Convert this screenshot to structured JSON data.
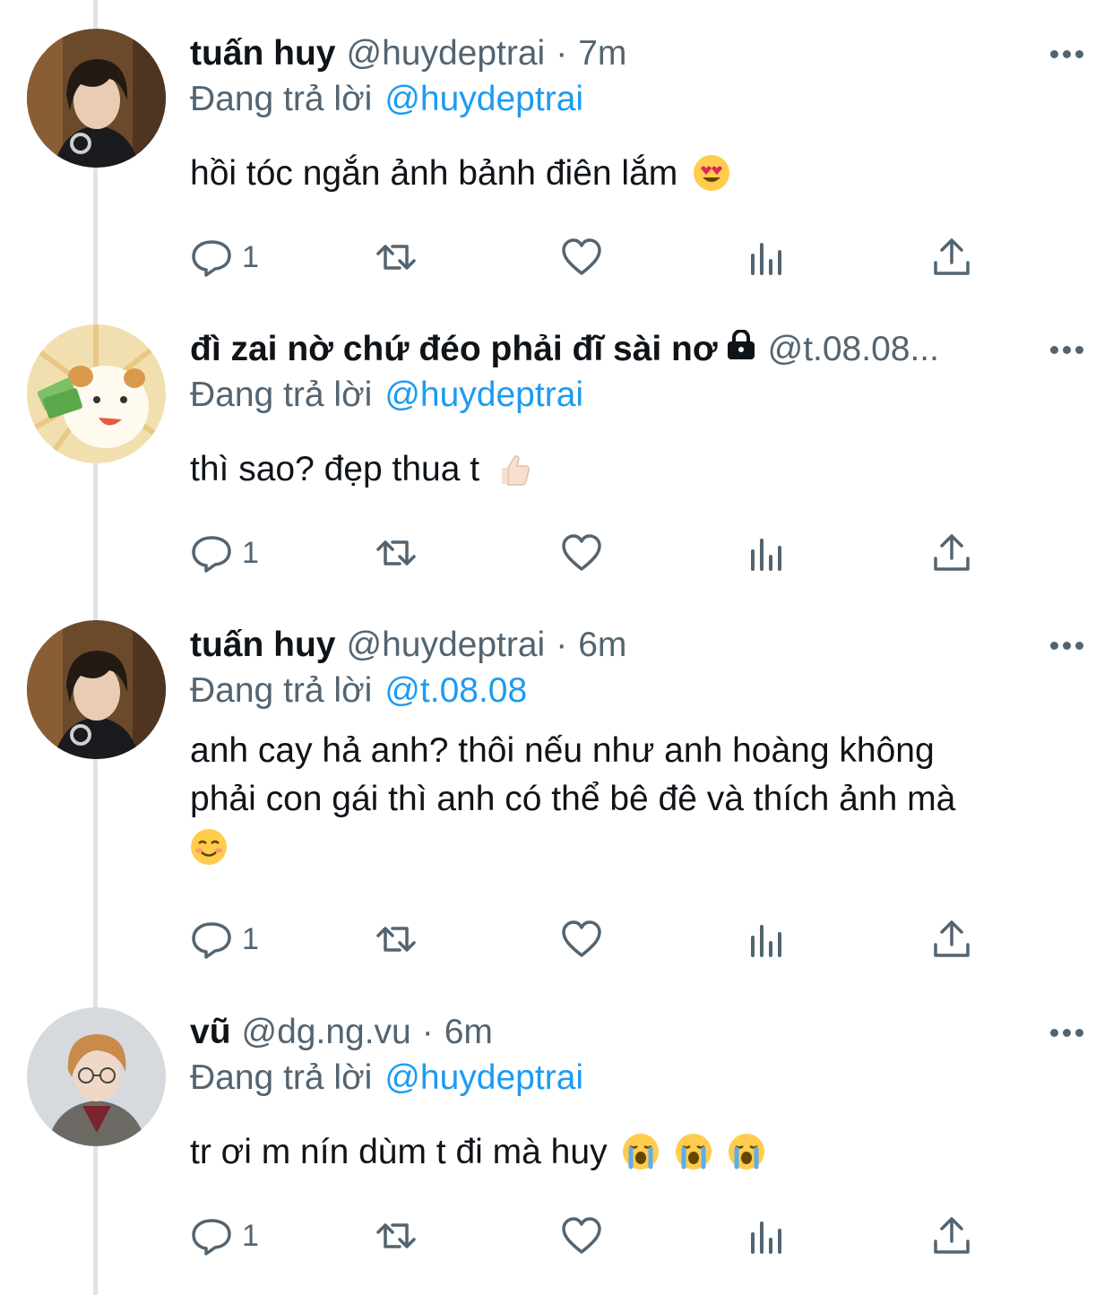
{
  "thread": {
    "reply_prefix": "Đang trả lời",
    "tweets": [
      {
        "name": "tuấn huy",
        "handle": "@huydeptrai",
        "time": "7m",
        "reply_to": "@huydeptrai",
        "text": "hồi tóc ngắn ảnh bảnh điên lắm",
        "emojis": [
          "heart-eyes-emoji"
        ],
        "reply_count": "1",
        "avatar": "man-dark-hair-headphones"
      },
      {
        "name": "đì zai nờ chứ đéo phải đĩ sài nơ",
        "handle": "@t.08.08...",
        "time": "",
        "locked": true,
        "reply_to": "@huydeptrai",
        "text": "thì sao? đẹp thua t",
        "emojis": [
          "thumbs-up-emoji"
        ],
        "reply_count": "1",
        "avatar": "cartoon-dog-money"
      },
      {
        "name": "tuấn huy",
        "handle": "@huydeptrai",
        "time": "6m",
        "reply_to": "@t.08.08",
        "text_lines": [
          "anh cay hả anh? thôi nếu như anh hoàng không",
          "phải con gái thì anh có thể bê đê và thích ảnh mà"
        ],
        "emojis": [
          "smiling-face-emoji"
        ],
        "reply_count": "1",
        "avatar": "man-dark-hair-headphones"
      },
      {
        "name": "vũ",
        "handle": "@dg.ng.vu",
        "time": "6m",
        "reply_to": "@huydeptrai",
        "text": "tr ơi m nín dùm t đi mà huy",
        "emojis": [
          "loudly-crying-emoji",
          "loudly-crying-emoji",
          "loudly-crying-emoji"
        ],
        "reply_count": "1",
        "avatar": "man-glasses-tweed-coat"
      }
    ]
  },
  "colors": {
    "primary_text": "#0f1419",
    "secondary_text": "#536471",
    "link": "#1d9bf0",
    "thread_line": "#dfe3e6"
  }
}
